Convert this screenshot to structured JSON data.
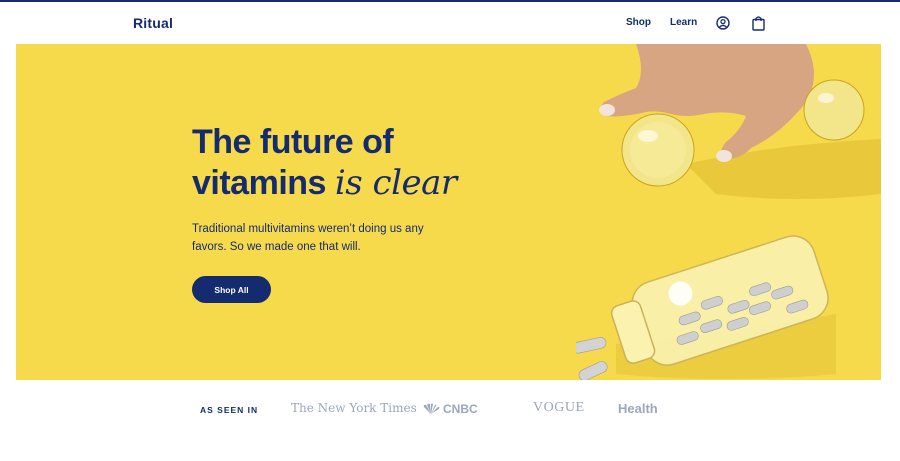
{
  "header": {
    "logo": "Ritual",
    "nav": {
      "shop": "Shop",
      "learn": "Learn"
    },
    "icons": [
      "account-icon",
      "shopping-bag-icon"
    ]
  },
  "hero": {
    "title_line1": "The future of",
    "title_line2_bold": "vitamins",
    "title_line2_italic": "is clear",
    "body": "Traditional multivitamins weren’t doing us any favors. So we made one that will.",
    "cta": "Shop All",
    "image": "hand-picking-clear-capsules-and-bottle-photo"
  },
  "press": {
    "label": "AS SEEN IN",
    "logos": [
      "The New York Times",
      "CNBC",
      "VOGUE",
      "Health"
    ]
  },
  "colors": {
    "navy": "#142b6f",
    "hero_bg": "#f7d94c",
    "press_gray": "#9ca6bd"
  }
}
